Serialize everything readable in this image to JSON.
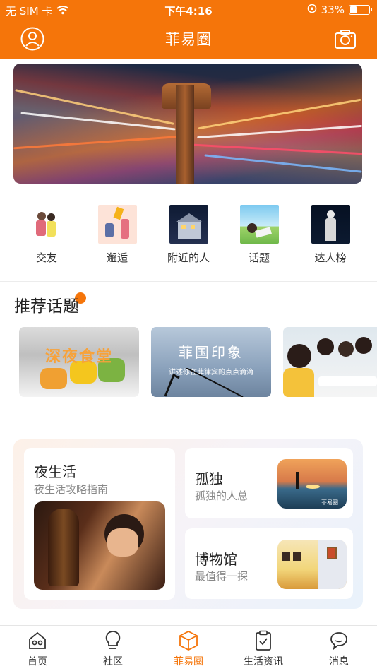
{
  "status_bar": {
    "carrier": "无 SIM 卡",
    "time": "下午4:16",
    "battery": "33%",
    "battery_level": 0.33
  },
  "nav": {
    "title": "菲易圈",
    "left_icon": "user-avatar-icon",
    "right_icon": "camera-icon"
  },
  "categories": [
    {
      "label": "交友"
    },
    {
      "label": "邂逅"
    },
    {
      "label": "附近的人"
    },
    {
      "label": "话题"
    },
    {
      "label": "达人榜"
    }
  ],
  "recommended": {
    "title": "推荐话题",
    "cards": [
      {
        "caption": "深夜食堂",
        "sub": ""
      },
      {
        "caption": "菲国印象",
        "sub": "讲述你在菲律宾的点点滴滴"
      },
      {
        "caption": "",
        "sub": ""
      }
    ]
  },
  "features": {
    "night": {
      "title": "夜生活",
      "subtitle": "夜生活攻略指南"
    },
    "lonely": {
      "title": "孤独",
      "subtitle": "孤独的人总",
      "watermark": "菲易圈"
    },
    "museum": {
      "title": "博物馆",
      "subtitle": "最值得一探"
    }
  },
  "tabs": [
    {
      "label": "首页",
      "icon": "home-icon"
    },
    {
      "label": "社区",
      "icon": "lightbulb-icon"
    },
    {
      "label": "菲易圈",
      "icon": "cube-icon",
      "active": true
    },
    {
      "label": "生活资讯",
      "icon": "clipboard-check-icon"
    },
    {
      "label": "消息",
      "icon": "chat-bubble-icon"
    }
  ],
  "colors": {
    "brand": "#f5750a",
    "text": "#222222",
    "muted": "#888888"
  }
}
